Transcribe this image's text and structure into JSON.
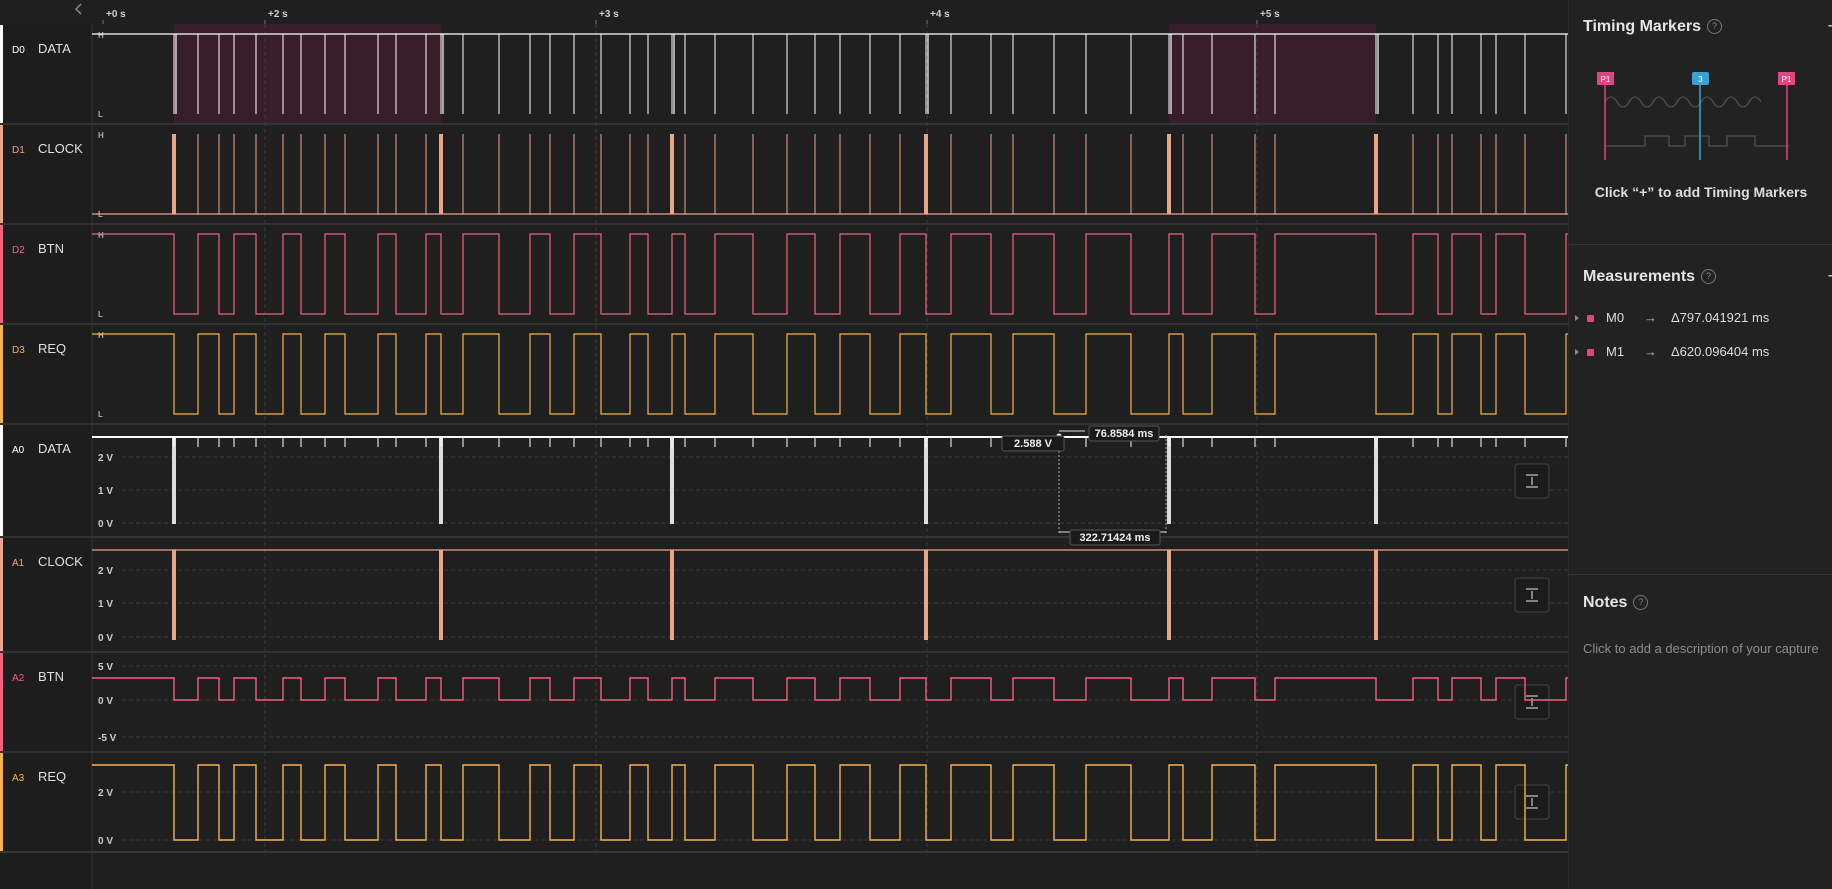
{
  "timeline": {
    "collapse_icon": "chevron-left-icon",
    "ticks": [
      "+0 s",
      "+2 s",
      "+3 s",
      "+4 s",
      "+5 s"
    ]
  },
  "channels": [
    {
      "id": "D0",
      "name": "DATA",
      "color": "#ffffff",
      "kind": "digital"
    },
    {
      "id": "D1",
      "name": "CLOCK",
      "color": "#e8a58a",
      "kind": "digital"
    },
    {
      "id": "D2",
      "name": "BTN",
      "color": "#f4607e",
      "kind": "digital"
    },
    {
      "id": "D3",
      "name": "REQ",
      "color": "#f5b24e",
      "kind": "digital"
    },
    {
      "id": "A0",
      "name": "DATA",
      "color": "#ffffff",
      "kind": "analog",
      "axis": [
        "2 V",
        "1 V",
        "0 V"
      ]
    },
    {
      "id": "A1",
      "name": "CLOCK",
      "color": "#e8a58a",
      "kind": "analog",
      "axis": [
        "2 V",
        "1 V",
        "0 V"
      ]
    },
    {
      "id": "A2",
      "name": "BTN",
      "color": "#f4607e",
      "kind": "analog",
      "axis": [
        "5 V",
        "0 V",
        "-5 V"
      ]
    },
    {
      "id": "A3",
      "name": "REQ",
      "color": "#f5b24e",
      "kind": "analog",
      "axis": [
        "2 V",
        "0 V"
      ]
    }
  ],
  "digital_level_labels": {
    "high": "H",
    "low": "L"
  },
  "measurement_overlay": {
    "voltage": "2.588 V",
    "width": "76.8584 ms",
    "period": "322.71424 ms"
  },
  "autoscale_icon": "fit-height-icon",
  "sidebar": {
    "timing_markers": {
      "title": "Timing Markers",
      "help_icon": "?",
      "add": "+",
      "marker_labels": [
        "P1",
        "3",
        "P1"
      ],
      "hint": "Click “+” to add Timing Markers"
    },
    "measurements": {
      "title": "Measurements",
      "help_icon": "?",
      "add": "+",
      "items": [
        {
          "name": "M0",
          "value": "Δ797.041921 ms"
        },
        {
          "name": "M1",
          "value": "Δ620.096404 ms"
        }
      ]
    },
    "notes": {
      "title": "Notes",
      "help_icon": "?",
      "placeholder": "Click to add a description of your capture"
    }
  },
  "colors": {
    "background": "#1f1f1f",
    "highlight": "#3a1f2a",
    "marker_red": "#e0467e",
    "marker_blue": "#3aa3d4"
  }
}
